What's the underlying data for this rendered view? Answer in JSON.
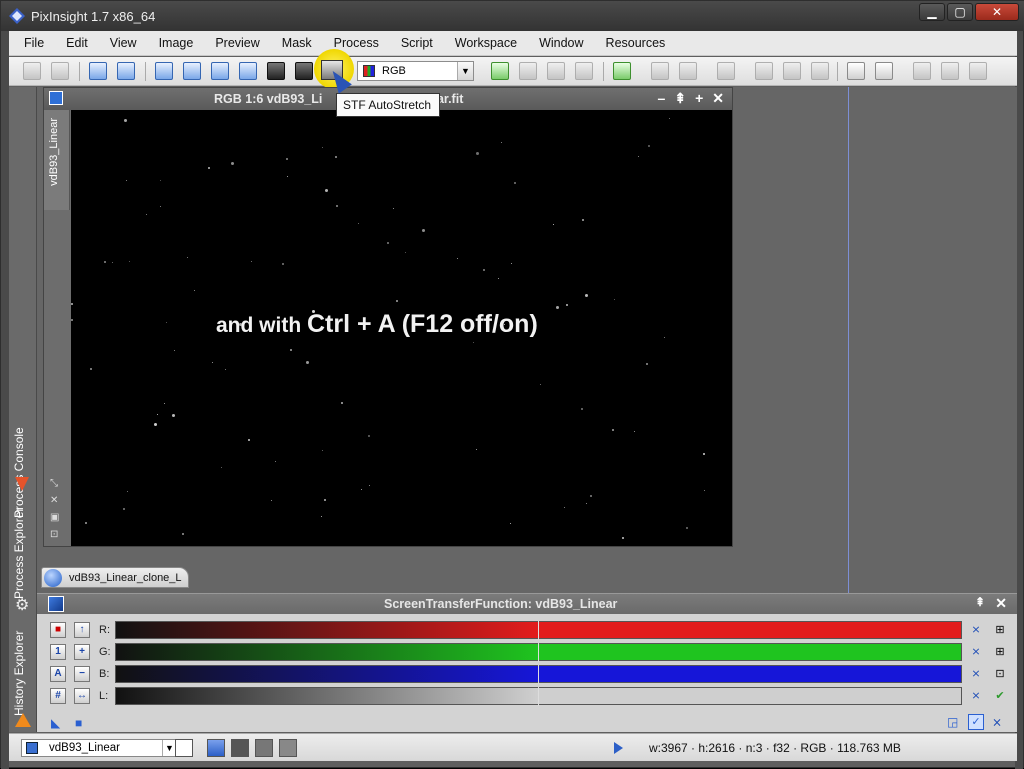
{
  "window": {
    "title": "PixInsight 1.7 x86_64"
  },
  "menu": [
    "File",
    "Edit",
    "View",
    "Image",
    "Preview",
    "Mask",
    "Process",
    "Script",
    "Workspace",
    "Window",
    "Resources"
  ],
  "toolbar": {
    "rgb_select": "RGB"
  },
  "tooltip": "STF AutoStretch",
  "image_window": {
    "title": "RGB 1:6 vdB93_Li",
    "title_tail": "near.fit",
    "side_tab": "vdB93_Linear",
    "overlay_prefix": "and with ",
    "overlay_big": "Ctrl + A (F12 off/on)"
  },
  "left_dock": {
    "tabs": [
      "Process Console",
      "Process Explorer",
      "History Explorer"
    ]
  },
  "icon_tab": "vdB93_Linear_clone_L",
  "stf_panel": {
    "title": "ScreenTransferFunction: vdB93_Linear",
    "channels": [
      {
        "label": "R:",
        "color": "#e21c1c"
      },
      {
        "label": "G:",
        "color": "#1fc41f"
      },
      {
        "label": "B:",
        "color": "#1616d8"
      },
      {
        "label": "L:",
        "color": "#cfcfcf"
      }
    ]
  },
  "statusbar": {
    "view": "vdB93_Linear",
    "info": "w:3967 · h:2616 · n:3 · f32 · RGB · 118.763 MB"
  }
}
